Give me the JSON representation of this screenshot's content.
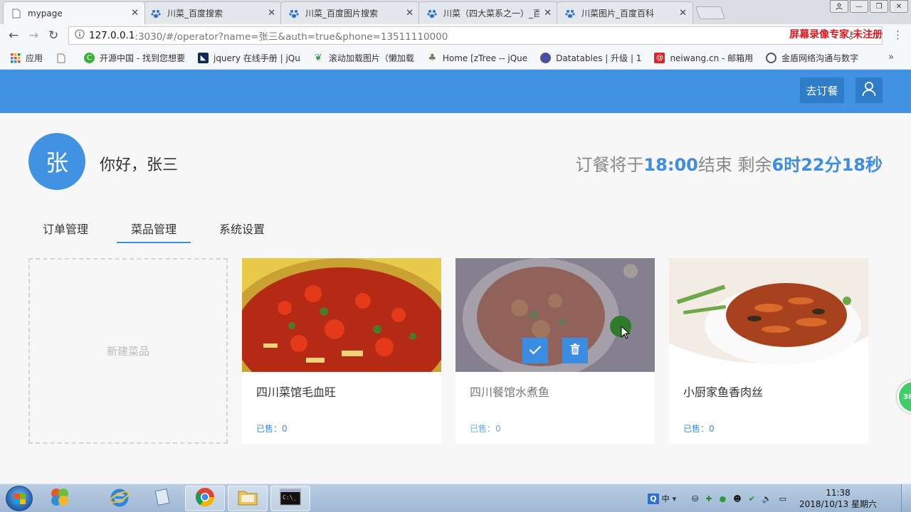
{
  "browser": {
    "tabs": [
      {
        "title": "mypage",
        "active": true
      },
      {
        "title": "川菜_百度搜索",
        "active": false
      },
      {
        "title": "川菜_百度图片搜索",
        "active": false
      },
      {
        "title": "川菜（四大菜系之一）_百",
        "active": false
      },
      {
        "title": "川菜图片_百度百科",
        "active": false
      }
    ],
    "url_host": "127.0.0.1",
    "url_path": ":3030/#/operator?name=张三&auth=true&phone=13511110000",
    "watermark": "屏幕录像专家 未注册",
    "bookmarks": [
      {
        "label": "应用",
        "icon": "apps-icon"
      },
      {
        "label": "",
        "icon": "page-icon"
      },
      {
        "label": "开源中国 - 找到您想要",
        "icon": "oschina-icon"
      },
      {
        "label": "jquery 在线手册 | jQu",
        "icon": "jquery-icon"
      },
      {
        "label": "滚动加载图片（懒加载",
        "icon": "leaf-icon"
      },
      {
        "label": "Home [zTree -- jQue",
        "icon": "ztree-icon"
      },
      {
        "label": "Datatables | 升级 | 1",
        "icon": "datatables-icon"
      },
      {
        "label": "neiwang.cn - 邮箱用",
        "icon": "mail-icon"
      },
      {
        "label": "金盾网络沟通与数字",
        "icon": "globe-icon"
      }
    ]
  },
  "header": {
    "order_button": "去订餐",
    "user_icon": "user-icon",
    "brand_color": "#4192e2"
  },
  "user": {
    "avatar_char": "张",
    "greeting": "你好，张三"
  },
  "countdown": {
    "prefix": "订餐将于",
    "end_time": "18:00",
    "middle": "结束 剩余",
    "remaining": "6时22分18秒"
  },
  "tabs": [
    {
      "label": "订单管理",
      "active": false
    },
    {
      "label": "菜品管理",
      "active": true
    },
    {
      "label": "系统设置",
      "active": false
    }
  ],
  "new_dish_label": "新建菜品",
  "dishes": [
    {
      "name": "四川菜馆毛血旺",
      "sold": "已售：0"
    },
    {
      "name": "四川餐馆水煮鱼",
      "sold": "已售：0",
      "hovered": true
    },
    {
      "name": "小厨家鱼香肉丝",
      "sold": "已售：0"
    }
  ],
  "side_bubble": "38",
  "taskbar": {
    "time": "11:38",
    "date": "2018/10/13 星期六",
    "ime": "中"
  }
}
